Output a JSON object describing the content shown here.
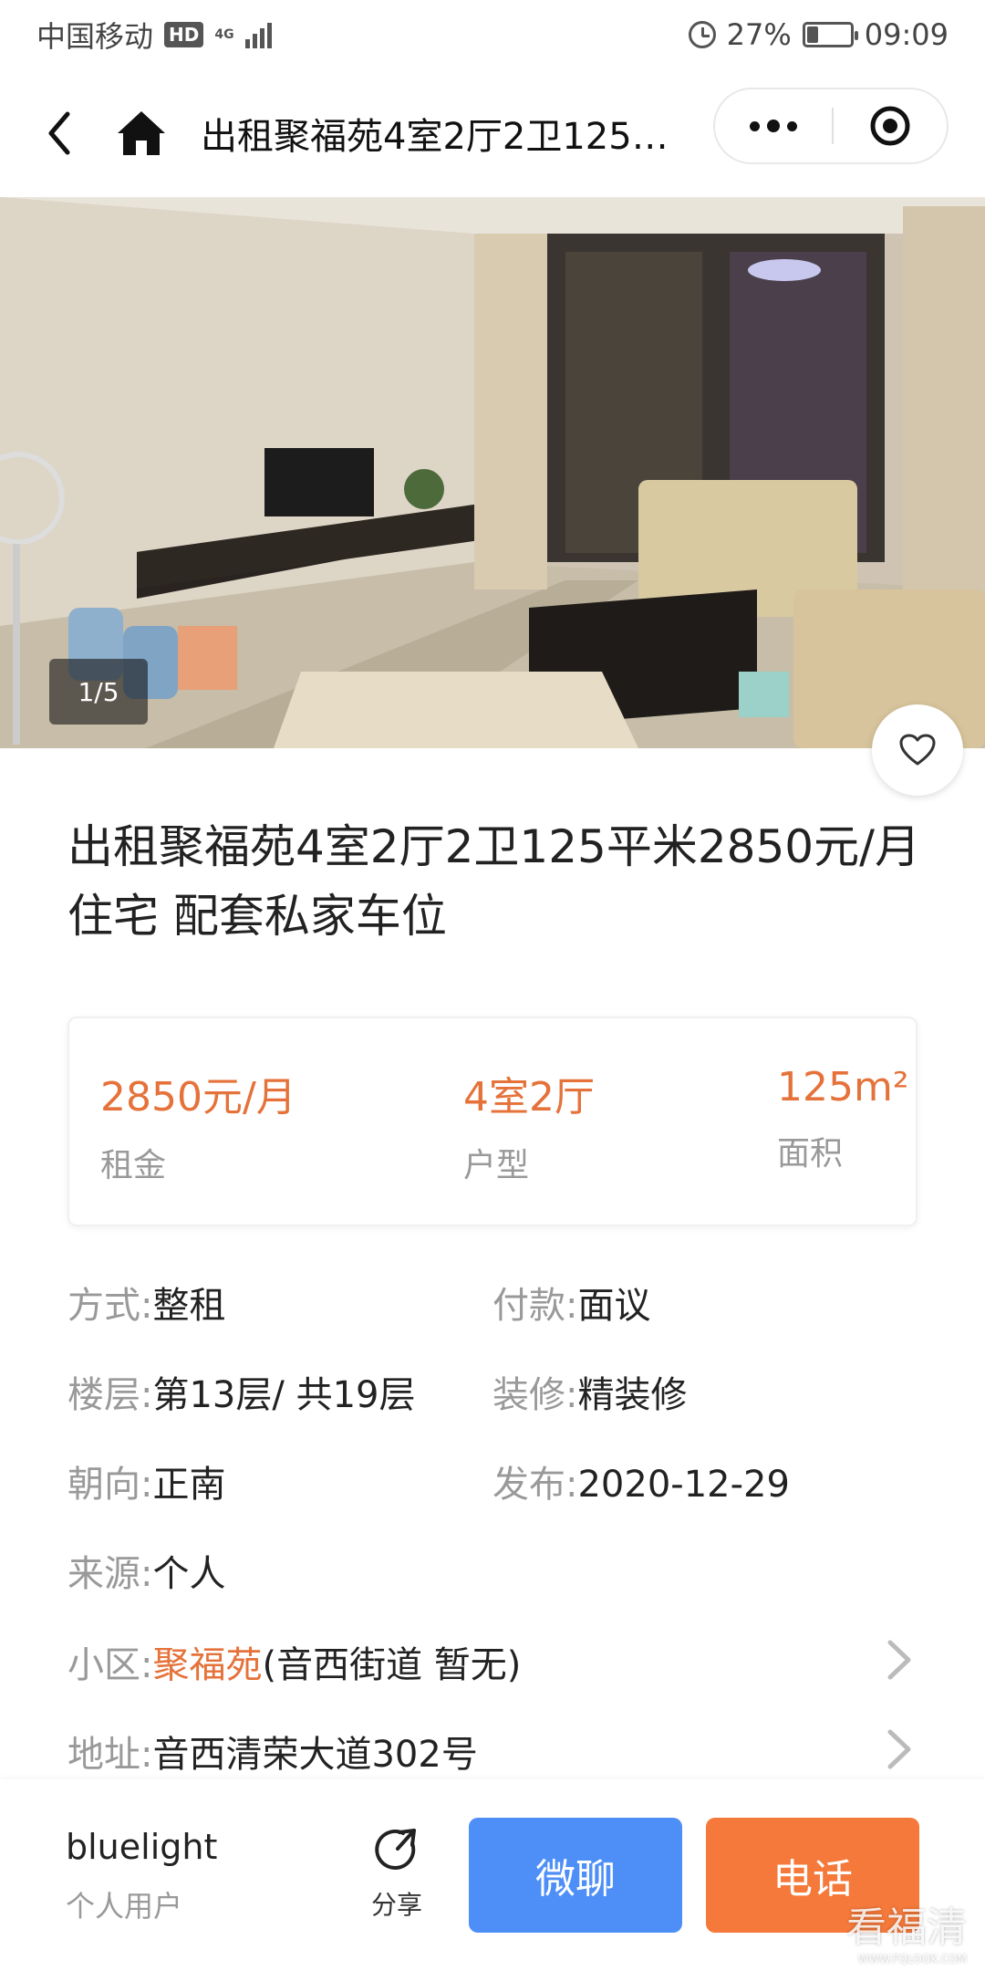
{
  "status_bar": {
    "carrier": "中国移动",
    "hd_badge": "HD",
    "network": "4G",
    "battery": "27%",
    "battery_level": 0.27,
    "time": "09:09"
  },
  "nav": {
    "title": "出租聚福苑4室2厅2卫125…"
  },
  "gallery": {
    "counter": "1/5"
  },
  "listing": {
    "title_line1": "出租聚福苑4室2厅2卫125平米2850元/月",
    "title_line2": "住宅 配套私家车位"
  },
  "summary": {
    "rent_value": "2850元/月",
    "rent_label": "租金",
    "layout_value": "4室2厅",
    "layout_label": "户型",
    "area_value": "125m²",
    "area_label": "面积"
  },
  "details": {
    "mode_label": "方式:",
    "mode_value": "整租",
    "payment_label": "付款:",
    "payment_value": "面议",
    "floor_label": "楼层:",
    "floor_value": "第13层/ 共19层",
    "decoration_label": "装修:",
    "decoration_value": "精装修",
    "orientation_label": "朝向:",
    "orientation_value": "正南",
    "published_label": "发布:",
    "published_value": "2020-12-29",
    "source_label": "来源:",
    "source_value": "个人",
    "community_label": "小区:",
    "community_value": "聚福苑",
    "community_extra": "(音西街道 暂无)",
    "address_label": "地址:",
    "address_value": "音西清荣大道302号"
  },
  "bottom": {
    "user_name": "bluelight",
    "user_type": "个人用户",
    "share_label": "分享",
    "chat_label": "微聊",
    "call_label": "电话",
    "watermark": "看福清",
    "watermark_url": "WWW.FQLOOK.COM"
  },
  "colors": {
    "accent_orange": "#e5723a",
    "chat_blue": "#4e8ff7",
    "call_orange": "#f5793a"
  },
  "icons": [
    "back-icon",
    "home-icon",
    "more-icon",
    "close-target-icon",
    "heart-icon",
    "share-icon",
    "chevron-right-icon",
    "alarm-icon",
    "battery-icon",
    "signal-icon"
  ]
}
